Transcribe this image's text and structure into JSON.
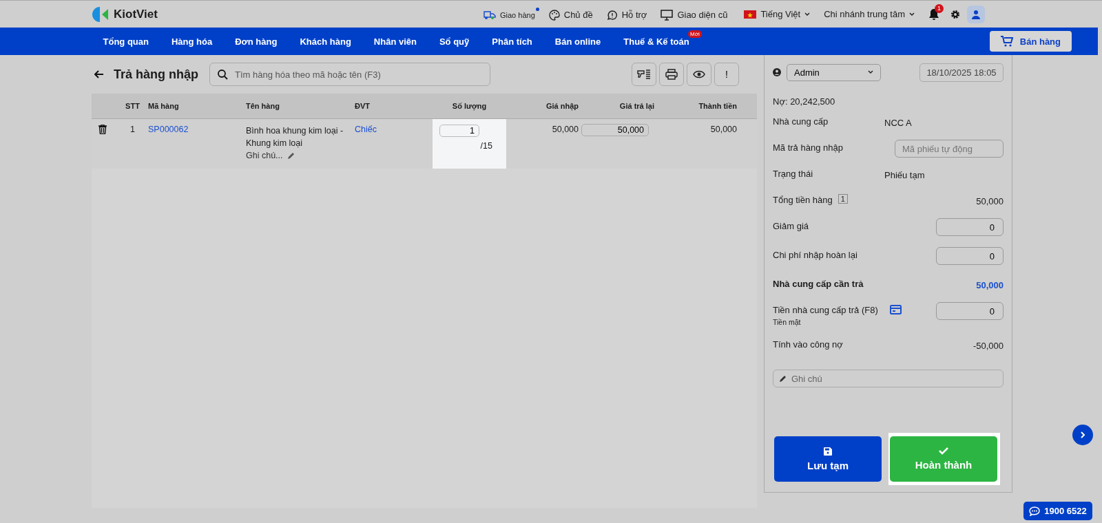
{
  "header": {
    "logo": "KiotViet",
    "links": [
      {
        "kind": "delivery",
        "label": "Giao hàng",
        "dot": true
      },
      {
        "kind": "palette",
        "label": "Chủ đề",
        "dot": false
      },
      {
        "kind": "support",
        "label": "Hỗ trợ",
        "dot": false
      },
      {
        "kind": "monitor",
        "label": "Giao diện cũ",
        "dot": false
      }
    ],
    "language": "Tiếng Việt",
    "branch": "Chi nhánh trung tâm",
    "notification_count": "1"
  },
  "nav": {
    "items": [
      {
        "label": "Tổng quan"
      },
      {
        "label": "Hàng hóa"
      },
      {
        "label": "Đơn hàng"
      },
      {
        "label": "Khách hàng"
      },
      {
        "label": "Nhân viên"
      },
      {
        "label": "Sổ quỹ"
      },
      {
        "label": "Phân tích"
      },
      {
        "label": "Bán online"
      },
      {
        "label": "Thuế & Kế toán",
        "badge": "Mới"
      }
    ],
    "sell_button": "Bán hàng"
  },
  "page": {
    "title": "Trả hàng nhập",
    "search": {
      "placeholder": "Tìm hàng hóa theo mã hoặc tên (F3)"
    },
    "toolbar": [
      {
        "kind": "barcode"
      },
      {
        "kind": "print"
      },
      {
        "kind": "eye"
      },
      {
        "kind": "text",
        "label": "!"
      }
    ]
  },
  "table": {
    "columns": [
      "STT",
      "Mã hàng",
      "Tên hàng",
      "ĐVT",
      "Số lượng",
      "Giá nhập",
      "Giá trả lại",
      "Thành tiền"
    ],
    "rows": [
      {
        "stt": "1",
        "code": "SP000062",
        "name": "Bình hoa khung kim loại - Khung kim loại",
        "note": "Ghi chú...",
        "unit": "Chiếc",
        "quantity": "1",
        "quantity_max": "/15",
        "quantity_highlighted": true,
        "import_price": "50,000",
        "return_price": "50,000",
        "total": "50,000"
      }
    ]
  },
  "side": {
    "user": "Admin",
    "datetime": "18/10/2025 18:05",
    "debt": "Nợ: 20,242,500",
    "fields": [
      {
        "kind": "text",
        "label": "Nhà cung cấp",
        "value": "NCC A"
      },
      {
        "kind": "input",
        "label": "Mã trả hàng nhập",
        "placeholder": "Mã phiếu tự động"
      },
      {
        "kind": "text",
        "label": "Trạng thái",
        "value": "Phiếu tạm"
      },
      {
        "kind": "count",
        "label": "Tổng tiền hàng",
        "badge": "1",
        "value": "50,000"
      },
      {
        "kind": "number",
        "label": "Giảm giá",
        "value": "0"
      },
      {
        "kind": "number",
        "label": "Chi phí nhập hoàn lại",
        "value": "0"
      },
      {
        "kind": "total",
        "label": "Nhà cung cấp cần trả",
        "value": "50,000"
      },
      {
        "kind": "payment",
        "label": "Tiền nhà cung cấp trả (F8)",
        "sublabel": "Tiền mặt",
        "value": "0"
      },
      {
        "kind": "amount",
        "label": "Tính vào công nợ",
        "value": "-50,000"
      }
    ],
    "note": {
      "placeholder": "Ghi chú"
    },
    "buttons": [
      {
        "kind": "save",
        "label": "Lưu tạm",
        "highlighted": false
      },
      {
        "kind": "complete",
        "label": "Hoàn thành",
        "highlighted": true
      }
    ]
  },
  "hotline": "1900 6522"
}
